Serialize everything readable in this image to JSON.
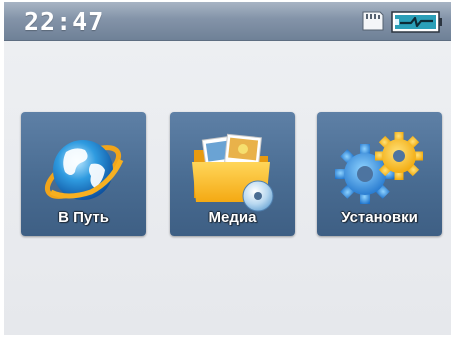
{
  "status_bar": {
    "time": "22:47",
    "sd_card_icon": "sd-card-icon",
    "battery_icon": "battery-charging-icon"
  },
  "menu": [
    {
      "label": "В Путь",
      "icon": "globe-icon"
    },
    {
      "label": "Медиа",
      "icon": "media-folder-icon"
    },
    {
      "label": "Установки",
      "icon": "gears-icon"
    }
  ],
  "colors": {
    "status_bar": "#8393a8",
    "tile": "#496c92",
    "screen_bg": "#eaecef",
    "label": "#ffffff"
  }
}
